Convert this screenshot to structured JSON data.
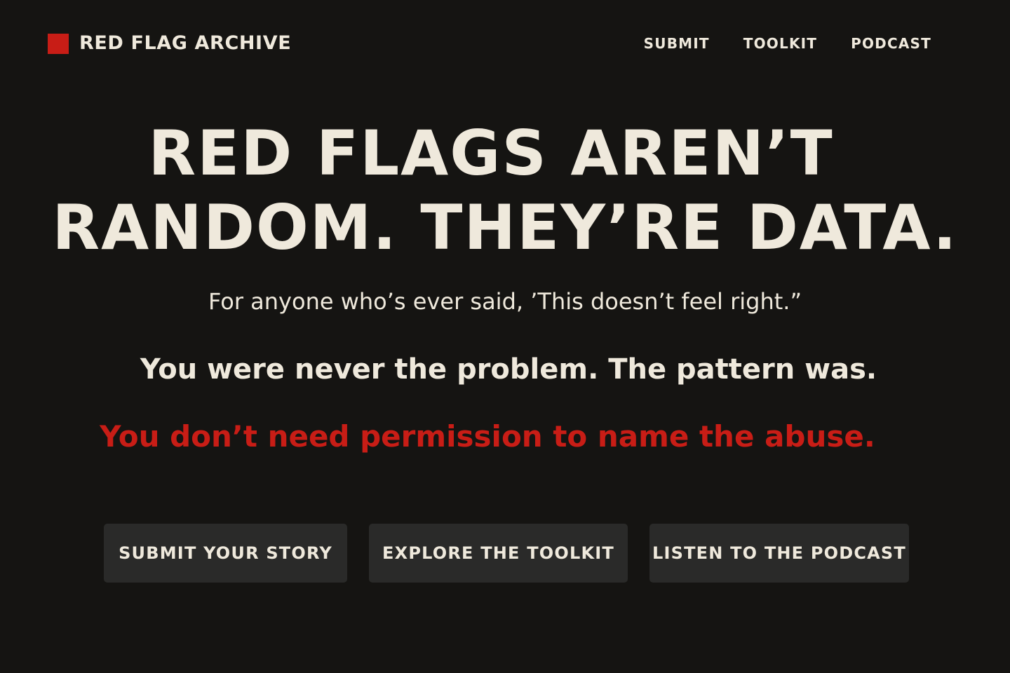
{
  "brand": {
    "name": "RED FLAG ARCHIVE",
    "accent_color": "#c81d16"
  },
  "nav": {
    "items": [
      {
        "label": "SUBMIT"
      },
      {
        "label": "TOOLKIT"
      },
      {
        "label": "PODCAST"
      }
    ]
  },
  "hero": {
    "headline_line1": "RED FLAGS AREN’T",
    "headline_line2": "RANDOM. THEY’RE DATA.",
    "quote": "For anyone who’s ever said, ’This doesn’t feel right.”",
    "pattern_line": "You were never the problem. The pattern was.",
    "permission_line": "You don’t need permission to name the abuse."
  },
  "cta": {
    "buttons": [
      {
        "label": "SUBMIT YOUR STORY"
      },
      {
        "label": "EXPLORE THE TOOLKIT"
      },
      {
        "label": "LISTEN TO THE PODCAST"
      }
    ]
  },
  "colors": {
    "background": "#151412",
    "text": "#efe9dc",
    "accent": "#c81d16",
    "button_bg": "#2a2a29"
  }
}
